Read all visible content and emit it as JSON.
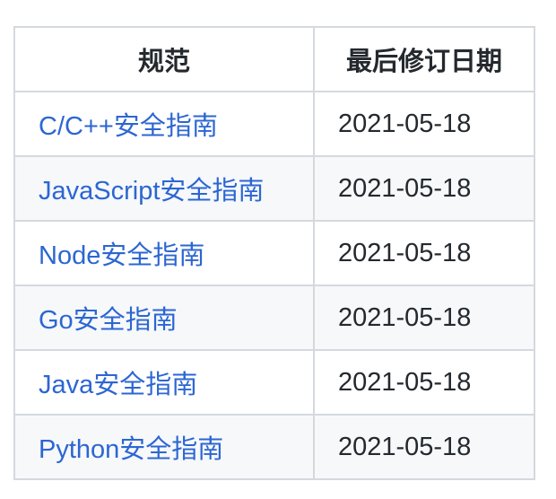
{
  "table": {
    "headers": [
      "规范",
      "最后修订日期"
    ],
    "rows": [
      {
        "name": "C/C++安全指南",
        "date": "2021-05-18"
      },
      {
        "name": "JavaScript安全指南",
        "date": "2021-05-18"
      },
      {
        "name": "Node安全指南",
        "date": "2021-05-18"
      },
      {
        "name": "Go安全指南",
        "date": "2021-05-18"
      },
      {
        "name": "Java安全指南",
        "date": "2021-05-18"
      },
      {
        "name": "Python安全指南",
        "date": "2021-05-18"
      }
    ]
  },
  "colors": {
    "link": "#2c66d2",
    "text": "#24292e",
    "border": "#d4d9df",
    "stripe": "#f6f8fa"
  }
}
